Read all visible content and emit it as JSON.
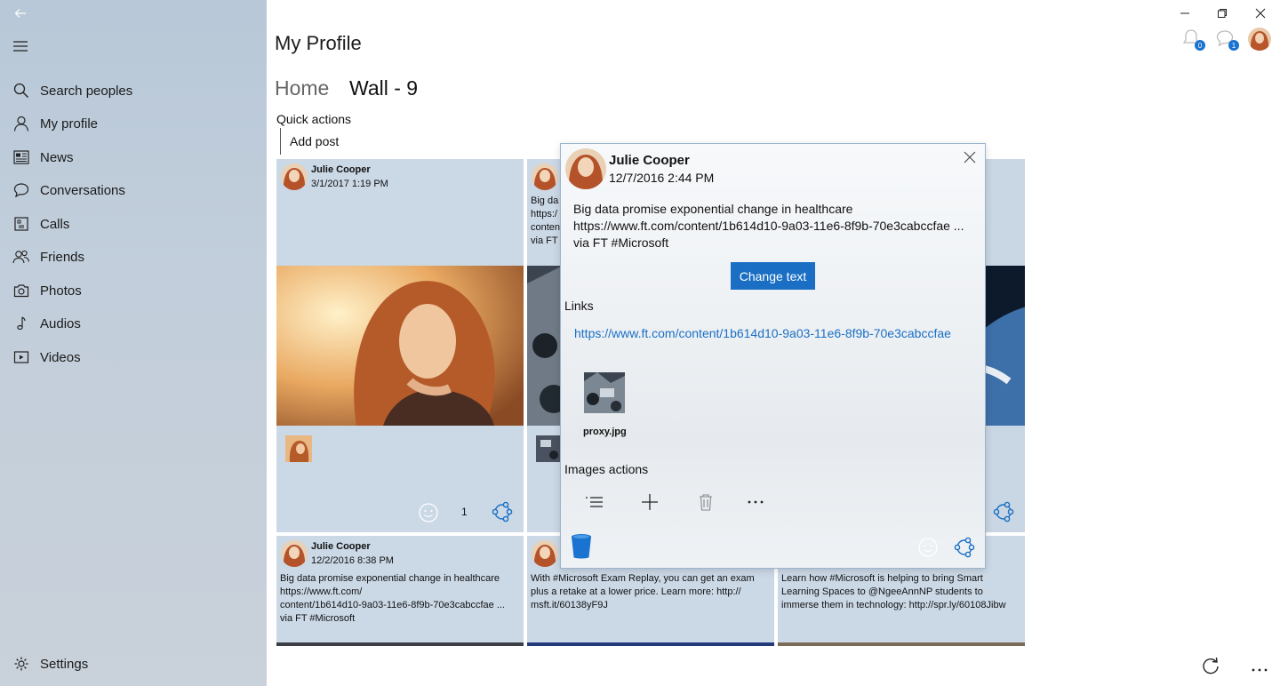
{
  "window": {
    "minimize": "minimize",
    "restore": "restore",
    "close": "close"
  },
  "sidebar": {
    "items": [
      {
        "label": "Search peoples",
        "icon": "search-icon"
      },
      {
        "label": "My profile",
        "icon": "person-icon"
      },
      {
        "label": "News",
        "icon": "news-icon"
      },
      {
        "label": "Conversations",
        "icon": "chat-icon"
      },
      {
        "label": "Calls",
        "icon": "phone-icon"
      },
      {
        "label": "Friends",
        "icon": "people-icon"
      },
      {
        "label": "Photos",
        "icon": "camera-icon"
      },
      {
        "label": "Audios",
        "icon": "music-icon"
      },
      {
        "label": "Videos",
        "icon": "video-icon"
      }
    ],
    "settings_label": "Settings"
  },
  "header": {
    "title": "My Profile",
    "notif_count": "0",
    "messages_count": "1"
  },
  "tabs": [
    {
      "label": "Home",
      "active": false
    },
    {
      "label": "Wall - 9",
      "active": true
    }
  ],
  "quick_actions": {
    "heading": "Quick actions",
    "add_post": "Add post"
  },
  "cards": [
    {
      "author": "Julie Cooper",
      "date": "3/1/2017 1:19 PM",
      "text": "",
      "like_count": "1"
    },
    {
      "author": "",
      "date": "",
      "text": "Big da\nhttps:/\nconten\nvia FT"
    },
    {
      "author": "Julie Cooper",
      "date": "12/2/2016 8:38 PM",
      "text": "Big data promise exponential change in healthcare\nhttps://www.ft.com/\ncontent/1b614d10-9a03-11e6-8f9b-70e3cabccfae ...\nvia FT #Microsoft"
    },
    {
      "text": "With #Microsoft Exam Replay, you can get an exam\nplus a retake at a lower price. Learn more: http://\nmsft.it/60138yF9J"
    },
    {
      "text": "Learn how #Microsoft is helping to bring Smart\nLearning Spaces to @NgeeAnnNP students to\nimmerse them in technology: http://spr.ly/60108Jibw"
    }
  ],
  "dialog": {
    "author": "Julie Cooper",
    "date": "12/7/2016 2:44 PM",
    "text": "Big data promise exponential change in healthcare\nhttps://www.ft.com/content/1b614d10-9a03-11e6-8f9b-70e3cabccfae ...\nvia FT #Microsoft",
    "change_text_label": "Change text",
    "links_heading": "Links",
    "link": "https://www.ft.com/content/1b614d10-9a03-11e6-8f9b-70e3cabccfae",
    "thumb_name": "proxy.jpg",
    "images_actions_heading": "Images actions"
  },
  "colors": {
    "accent": "#1a6fc4",
    "sidebar": "#c2cedb",
    "card": "#cbd8e6"
  }
}
